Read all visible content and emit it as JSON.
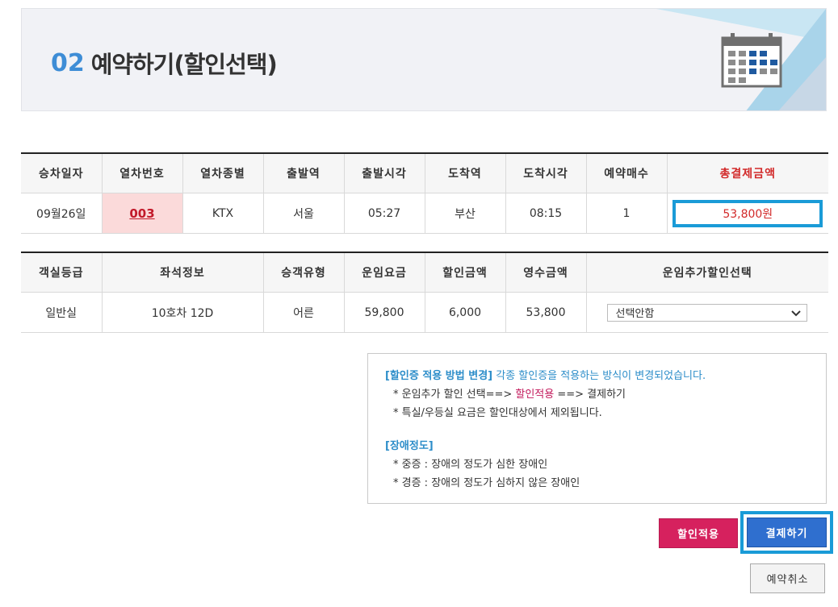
{
  "header": {
    "step": "02",
    "title": "예약하기(할인선택)",
    "icon": "calendar-icon"
  },
  "trip": {
    "headers": [
      "승차일자",
      "열차번호",
      "열차종별",
      "출발역",
      "출발시각",
      "도착역",
      "도착시각",
      "예약매수",
      "총결제금액"
    ],
    "date": "09월26일",
    "train_no": "003",
    "train_type": "KTX",
    "dep_station": "서울",
    "dep_time": "05:27",
    "arr_station": "부산",
    "arr_time": "08:15",
    "count": "1",
    "total": "53,800원"
  },
  "fare": {
    "headers": [
      "객실등급",
      "좌석정보",
      "승객유형",
      "운임요금",
      "할인금액",
      "영수금액",
      "운임추가할인선택"
    ],
    "class": "일반실",
    "seat": "10호차 12D",
    "passenger": "어른",
    "fare": "59,800",
    "discount": "6,000",
    "paid": "53,800",
    "select_value": "선택안함"
  },
  "notice": {
    "title": "[할인증 적용 방법 변경]",
    "title_rest": " 각종 할인증을 적용하는 방식이 변경되었습니다.",
    "line1_a": "* 운임추가 할인 선택==> ",
    "line1_b": "할인적용",
    "line1_c": " ==> 결제하기",
    "line2": "* 특실/우등실 요금은 할인대상에서 제외됩니다.",
    "title2": "[장애정도]",
    "line3": "* 중증 : 장애의 정도가 심한 장애인",
    "line4": "* 경증 : 장애의 정도가 심하지 않은 장애인"
  },
  "buttons": {
    "apply": "할인적용",
    "pay": "결제하기",
    "cancel": "예약취소"
  },
  "colors": {
    "accent_blue": "#1a9bd7",
    "total_red": "#d22a2a",
    "apply_pink": "#d6215e",
    "pay_blue": "#2f6fcf"
  }
}
